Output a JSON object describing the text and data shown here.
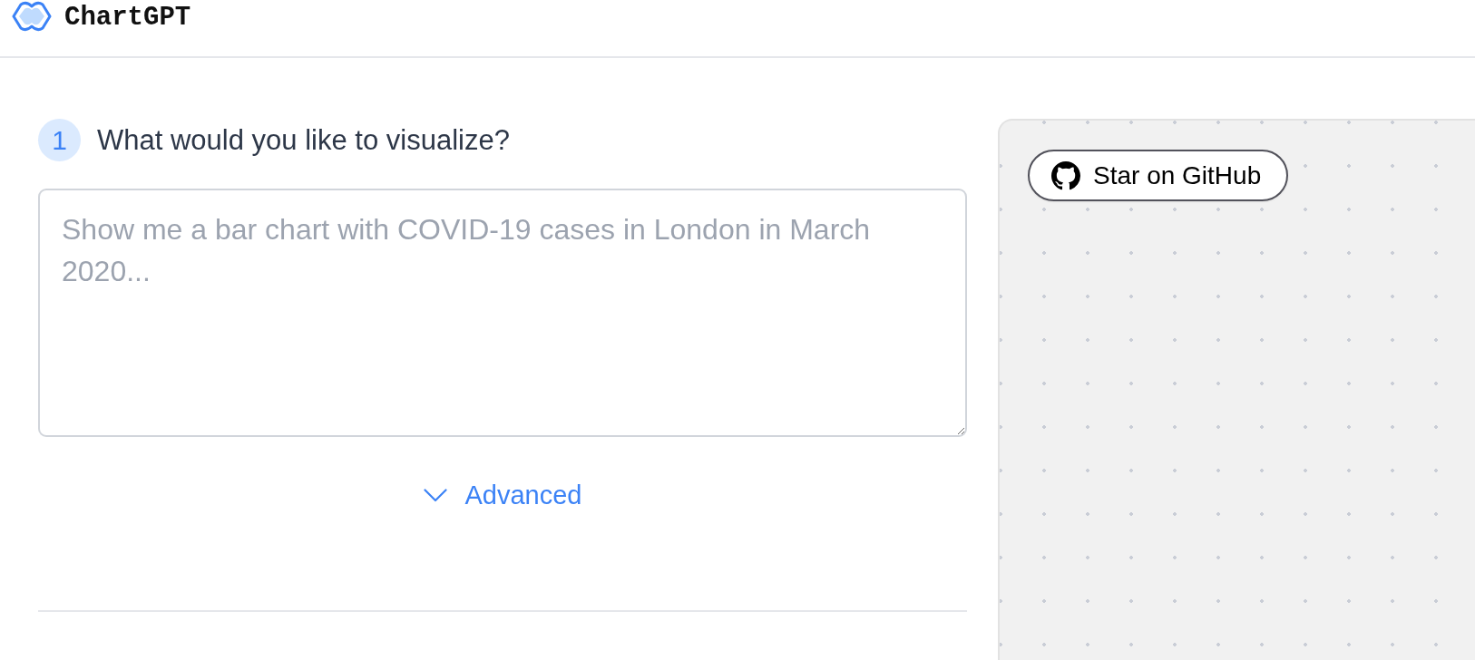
{
  "header": {
    "logo_text": "ChartGPT"
  },
  "steps": [
    {
      "number": "1",
      "question": "What would you like to visualize?",
      "input": {
        "placeholder": "Show me a bar chart with COVID-19 cases in London in March 2020..."
      }
    }
  ],
  "advanced": {
    "label": "Advanced",
    "expanded": false
  },
  "canvas": {
    "github_button": {
      "label": "Star on GitHub"
    }
  }
}
